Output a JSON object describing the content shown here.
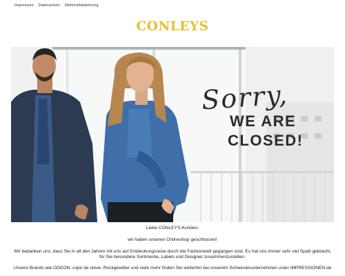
{
  "nav": {
    "items": [
      "Impressum",
      "Datenschutz",
      "Widerrufsbelehrung"
    ]
  },
  "brand": {
    "logo_text": "CONLEYS",
    "color": "#e4bf3a"
  },
  "hero": {
    "script_text": "Sorry,",
    "headline_line1": "WE ARE",
    "headline_line2": "CLOSED!"
  },
  "message": {
    "greeting": "Liebe CONLEYS-Kunden,",
    "closed_notice": "wir haben unseren Onlineshop geschlossen!",
    "thanks": "Wir bedanken uns, dass Sie in all den Jahren mit uns auf Entdeckungsreise durch die Fashionwelt gegangen sind. Es hat uns immer sehr viel Spaß gebracht, für Sie besondere Sortimente, Labels und Designer zusammenzustellen.",
    "brands": "Unsere Brands wie ODEON, copo de nieve, Rockgewitter und viele mehr finden Sie weiterhin bei unserem Schwesterunternehmen unter",
    "link": "IMPRESSIONEN.de"
  }
}
